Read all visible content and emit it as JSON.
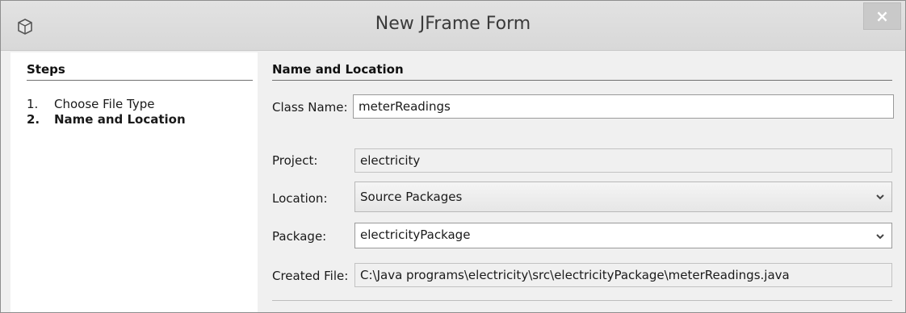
{
  "window": {
    "title": "New JFrame Form",
    "close_label": "×"
  },
  "steps": {
    "heading": "Steps",
    "items": [
      {
        "number": "1.",
        "label": "Choose File Type"
      },
      {
        "number": "2.",
        "label": "Name and Location"
      }
    ]
  },
  "form": {
    "heading": "Name and Location",
    "class_name": {
      "label": "Class Name:",
      "value": "meterReadings"
    },
    "project": {
      "label": "Project:",
      "value": "electricity"
    },
    "location": {
      "label": "Location:",
      "value": "Source Packages"
    },
    "package": {
      "label": "Package:",
      "value": "electricityPackage"
    },
    "created_file": {
      "label": "Created File:",
      "value": "C:\\Java programs\\electricity\\src\\electricityPackage\\meterReadings.java"
    }
  }
}
